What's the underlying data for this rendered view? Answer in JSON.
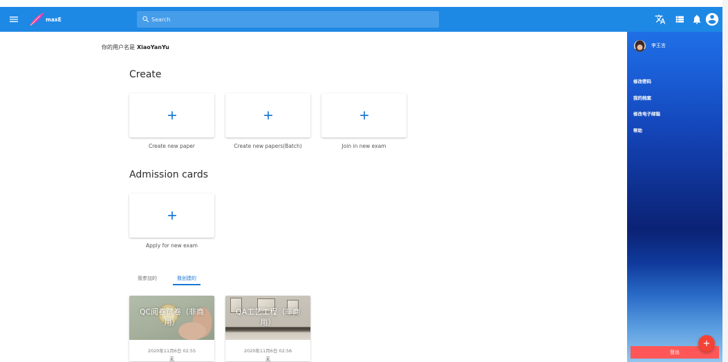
{
  "topbar": {
    "logo_text": "maxE",
    "search_placeholder": "Search"
  },
  "main": {
    "username_prefix": "你的用户名是",
    "username": "XiaoYanYu",
    "create": {
      "title": "Create",
      "cards": [
        {
          "label": "Create new paper"
        },
        {
          "label": "Create new papers(Batch)"
        },
        {
          "label": "Join in new exam"
        }
      ]
    },
    "admission": {
      "title": "Admission cards",
      "cards": [
        {
          "label": "Apply for new exam"
        }
      ]
    },
    "tabs": [
      {
        "label": "我参加的",
        "active": false
      },
      {
        "label": "我创建的",
        "active": true
      }
    ],
    "papers": [
      {
        "title": "QC阅卷试卷（非商用）",
        "date": "2020年11月6日 02:55",
        "note": "无"
      },
      {
        "title": "QA工艺工程（非商用）",
        "date": "2020年11月6日 02:56",
        "note": "无"
      }
    ]
  },
  "sidebar": {
    "user_name": "李王言",
    "items": [
      {
        "label": "修改密码"
      },
      {
        "label": "我的档案"
      },
      {
        "label": "修改电子邮箱"
      },
      {
        "label": "帮助"
      }
    ],
    "logout_label": "登出"
  },
  "icons": {
    "menu": "menu-icon",
    "search": "search-icon",
    "translate": "translate-icon",
    "view": "view-list-icon",
    "notifications": "bell-icon",
    "account": "account-circle-icon",
    "add": "add-icon"
  },
  "colors": {
    "primary": "#1e88e5",
    "link": "#1976d2",
    "accent": "#f44336",
    "logout": "#ff5757"
  }
}
